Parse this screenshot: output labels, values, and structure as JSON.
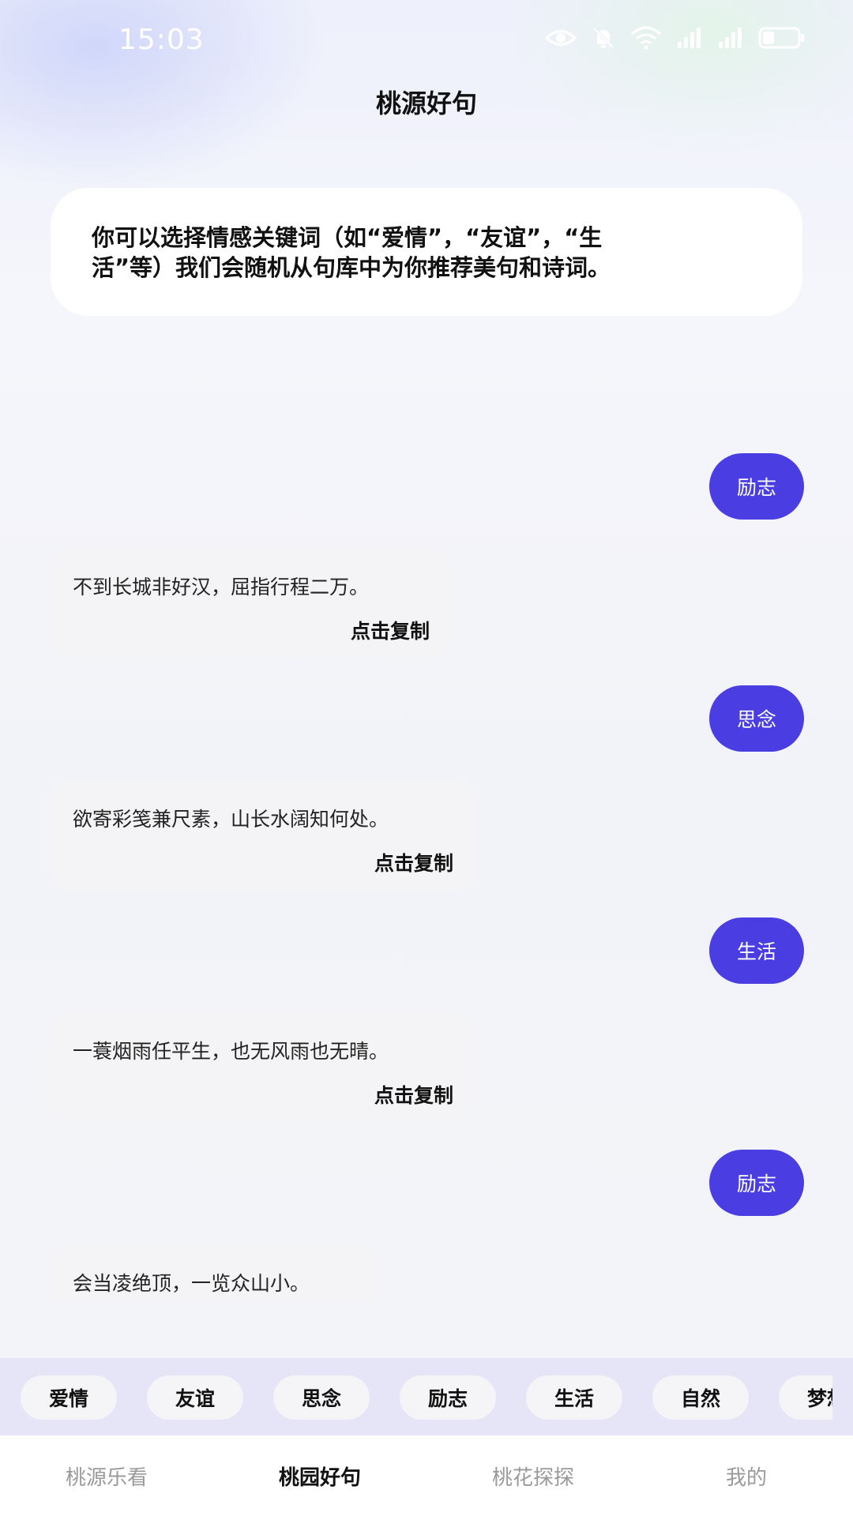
{
  "status_bar": {
    "time": "15:03",
    "icons": [
      "eye-icon",
      "bell-off-icon",
      "wifi-icon",
      "signal-icon",
      "signal-icon",
      "battery-icon"
    ]
  },
  "header": {
    "title": "桃源好句"
  },
  "intro": {
    "line1": "你可以选择情感关键词（如“爱情”，“友谊”，“生",
    "line2": "活”等）我们会随机从句库中为你推荐美句和诗词。"
  },
  "messages": [
    {
      "role": "user",
      "text": "励志"
    },
    {
      "role": "bot",
      "text": "不到长城非好汉，屈指行程二万。",
      "copy_label": "点击复制"
    },
    {
      "role": "user",
      "text": "思念"
    },
    {
      "role": "bot",
      "text": "欲寄彩笺兼尺素，山长水阔知何处。",
      "copy_label": "点击复制"
    },
    {
      "role": "user",
      "text": "生活"
    },
    {
      "role": "bot",
      "text": "一蓑烟雨任平生，也无风雨也无晴。",
      "copy_label": "点击复制"
    },
    {
      "role": "user",
      "text": "励志"
    },
    {
      "role": "bot",
      "text": "会当凌绝顶，一览众山小。"
    }
  ],
  "keywords": [
    "爱情",
    "友谊",
    "思念",
    "励志",
    "生活",
    "自然",
    "梦想"
  ],
  "tabs": [
    {
      "label": "桃源乐看",
      "active": false
    },
    {
      "label": "桃园好句",
      "active": true
    },
    {
      "label": "桃花探探",
      "active": false
    },
    {
      "label": "我的",
      "active": false
    }
  ],
  "colors": {
    "accent": "#4a3ee3",
    "keyword_bar": "#e6e5f8",
    "bubble": "#f4f4f6"
  }
}
